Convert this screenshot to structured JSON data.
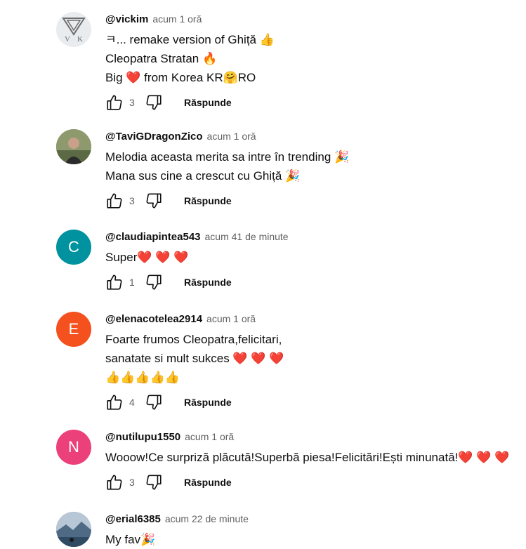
{
  "labels": {
    "reply": "Răspunde"
  },
  "comments": [
    {
      "author": "@vickim",
      "time": "acum 1 oră",
      "avatar": {
        "type": "logo",
        "letters": "V K",
        "bg": "#e9ecef"
      },
      "lines": [
        "ㅋ... remake version of Ghiță 👍",
        "Cleopatra Stratan 🔥",
        "Big ❤️ from Korea KR🤗RO"
      ],
      "likes": "3"
    },
    {
      "author": "@TaviGDragonZico",
      "time": "acum 1 oră",
      "avatar": {
        "type": "photo",
        "bg": "#7a8a6a"
      },
      "lines": [
        "Melodia aceasta merita sa intre în trending 🎉",
        "Mana sus cine a crescut cu Ghiță 🎉"
      ],
      "likes": "3"
    },
    {
      "author": "@claudiapintea543",
      "time": "acum 41 de minute",
      "avatar": {
        "type": "letter",
        "letter": "C",
        "bg": "#00929e"
      },
      "lines": [
        "Super❤️ ❤️ ❤️"
      ],
      "likes": "1"
    },
    {
      "author": "@elenacotelea2914",
      "time": "acum 1 oră",
      "avatar": {
        "type": "letter",
        "letter": "E",
        "bg": "#f4511e"
      },
      "lines": [
        "Foarte frumos Cleopatra,felicitari,",
        "sanatate si mult sukces ❤️ ❤️ ❤️",
        "👍👍👍👍👍"
      ],
      "likes": "4"
    },
    {
      "author": "@nutilupu1550",
      "time": "acum 1 oră",
      "avatar": {
        "type": "letter",
        "letter": "N",
        "bg": "#ec407a"
      },
      "lines": [
        "Wooow!Ce surpriză plăcută!Superbă piesa!Felicitări!Ești minunată!❤️ ❤️ ❤️"
      ],
      "likes": "3"
    },
    {
      "author": "@erial6385",
      "time": "acum 22 de minute",
      "avatar": {
        "type": "photo",
        "bg": "#5d7c99"
      },
      "lines": [
        "My fav🎉"
      ],
      "likes": ""
    }
  ]
}
